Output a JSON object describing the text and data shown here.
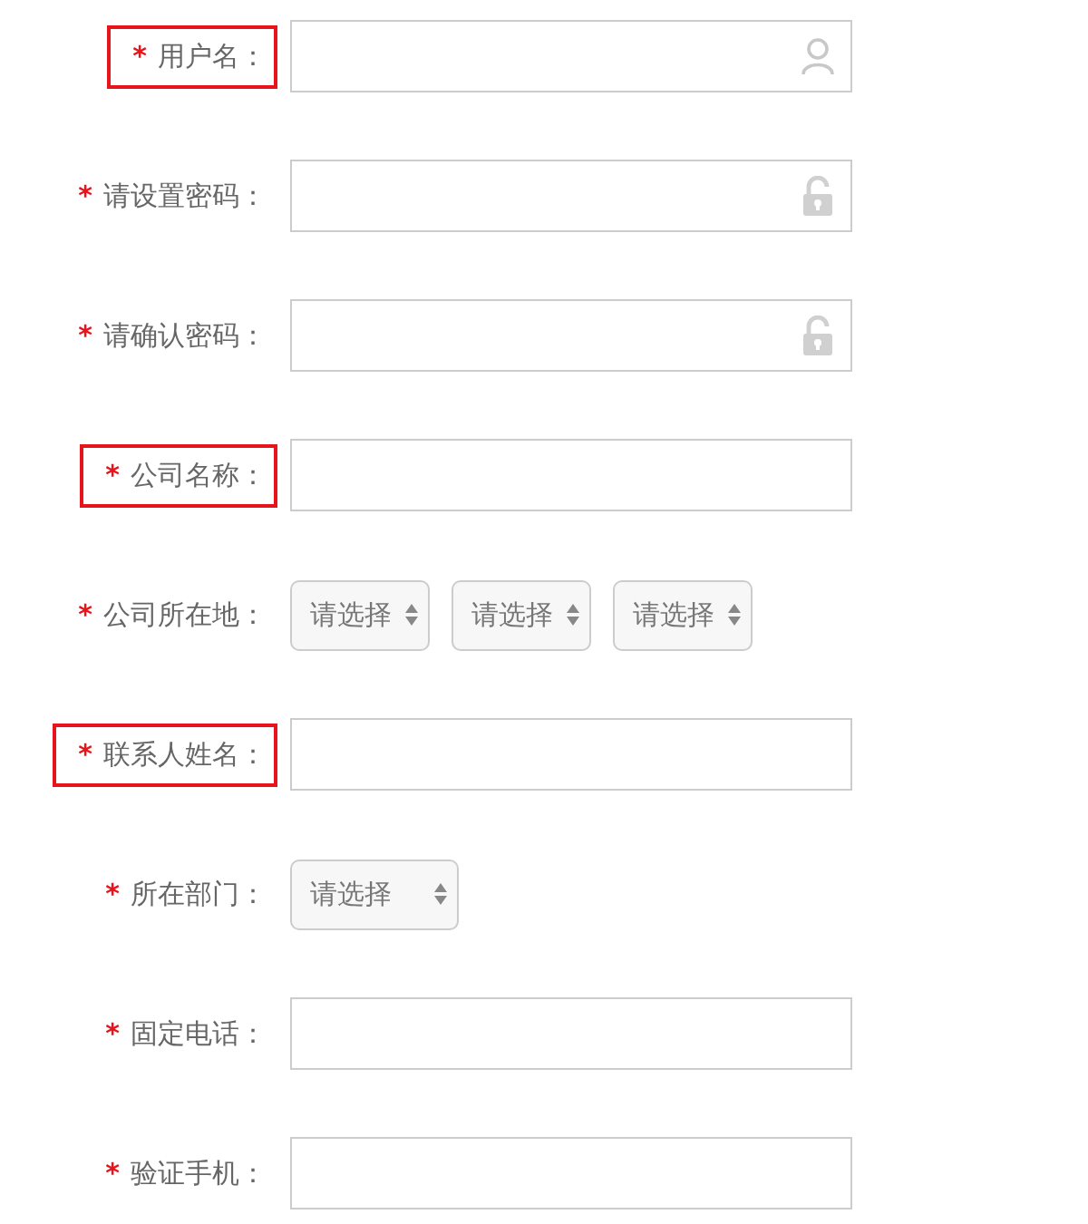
{
  "fields": [
    {
      "marker": "*",
      "label": "用户名：",
      "highlighted": true,
      "kind": "username"
    },
    {
      "marker": "*",
      "label": "请设置密码：",
      "highlighted": false,
      "kind": "password"
    },
    {
      "marker": "*",
      "label": "请确认密码：",
      "highlighted": false,
      "kind": "password"
    },
    {
      "marker": "*",
      "label": "公司名称：",
      "highlighted": true,
      "kind": "text"
    },
    {
      "marker": "*",
      "label": "公司所在地：",
      "highlighted": false,
      "kind": "select",
      "options": [
        "请选择",
        "请选择",
        "请选择"
      ]
    },
    {
      "marker": "*",
      "label": "联系人姓名：",
      "highlighted": true,
      "kind": "text"
    },
    {
      "marker": "*",
      "label": "所在部门：",
      "highlighted": false,
      "kind": "select",
      "options": [
        "请选择"
      ]
    },
    {
      "marker": "*",
      "label": "固定电话：",
      "highlighted": false,
      "kind": "text"
    },
    {
      "marker": "*",
      "label": "验证手机：",
      "highlighted": false,
      "kind": "text"
    }
  ]
}
